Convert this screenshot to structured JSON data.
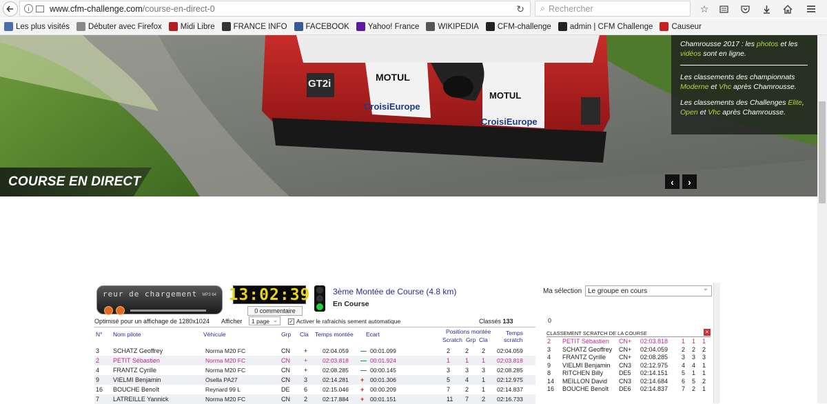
{
  "browser": {
    "url_host": "www.cfm-challenge.com",
    "url_path": "/course-en-direct-0",
    "search_placeholder": "Rechercher"
  },
  "bookmarks": [
    {
      "label": "Les plus visités",
      "icon": "star-folder-icon",
      "color": "#4a6ea9"
    },
    {
      "label": "Débuter avec Firefox",
      "icon": "firefox-icon",
      "color": "#888888"
    },
    {
      "label": "Midi Libre",
      "icon": "midi-libre-icon",
      "color": "#b01e1e"
    },
    {
      "label": "FRANCE INFO",
      "icon": "franceinfo-icon",
      "color": "#333333"
    },
    {
      "label": "FACEBOOK",
      "icon": "facebook-icon",
      "color": "#3b5998"
    },
    {
      "label": "Yahoo! France",
      "icon": "yahoo-icon",
      "color": "#5c1aa3"
    },
    {
      "label": "WIKIPEDIA",
      "icon": "wikipedia-icon",
      "color": "#555555"
    },
    {
      "label": "CFM-challenge",
      "icon": "cfm-icon",
      "color": "#222222"
    },
    {
      "label": "admin | CFM Challenge",
      "icon": "cfm-admin-icon",
      "color": "#222222"
    },
    {
      "label": "Causeur",
      "icon": "causeur-icon",
      "color": "#c62020"
    }
  ],
  "hero": {
    "title": "COURSE EN DIRECT",
    "news": {
      "p1_a": "Chamrousse 2017 : les ",
      "p1_link1": "photos",
      "p1_b": " et les ",
      "p1_link2": "vidéos",
      "p1_c": " sont en ligne.",
      "p2_a": "Les classements des championnats ",
      "p2_link1": "Moderne",
      "p2_b": " et ",
      "p2_link2": "Vhc",
      "p2_c": " après Chamrousse.",
      "p3_a": "Les classements des Challenges ",
      "p3_link1": "Elite",
      "p3_b": ", ",
      "p3_link2": "Open",
      "p3_c": " et ",
      "p3_link3": "Vhc",
      "p3_d": " après Chamrousse."
    }
  },
  "widget": {
    "player_text": "reur de chargement",
    "player_badge": "MP3 64",
    "clock": "13:02:39",
    "comment_button": "0 commentaire",
    "run_title": "3ème Montée de Course (4.8 km)",
    "run_status": "En Course",
    "optimised": "Optimisé pour un affichage de 1280x1024",
    "show_label": "Afficher",
    "page_select": "1 page",
    "auto_refresh": "Activer le rafraichis sement automatique",
    "classes_label": "Classés",
    "classes_count": "133",
    "my_selection_label": "Ma sélection",
    "my_selection_value": "Le groupe en cours",
    "side_counter": "0",
    "side_title": "CLASSEMENT SCRATCH DE LA COURSE",
    "headers": {
      "num": "N°",
      "pilot": "Nom pilote",
      "vehicle": "Véhicule",
      "grp": "Grp",
      "cla": "Cla",
      "time": "Temps montée",
      "gap": "Ecart",
      "positions": "Positions montée",
      "scratch": "Scratch",
      "pgrp": "Grp",
      "pcla": "Cla",
      "stime1": "Temps",
      "stime2": "scratch"
    },
    "rows": [
      {
        "num": "3",
        "pilot": "SCHATZ Geoffrey",
        "vehicle": "Norma M20 FC",
        "grp": "CN",
        "cla": "+",
        "time": "02:04.059",
        "sign": "—",
        "gap": "00:01.099",
        "scratch": "2",
        "pgrp": "2",
        "pcla": "2",
        "stime": "02:04.059",
        "me": false
      },
      {
        "num": "2",
        "pilot": "PETIT Sébastien",
        "vehicle": "Norma M20 FC",
        "grp": "CN",
        "cla": "+",
        "time": "02:03.818",
        "sign": "—",
        "gap": "00:01.924",
        "scratch": "1",
        "pgrp": "1",
        "pcla": "1",
        "stime": "02:03.818",
        "me": true
      },
      {
        "num": "4",
        "pilot": "FRANTZ Cyrille",
        "vehicle": "Norma M20 FC",
        "grp": "CN",
        "cla": "+",
        "time": "02:08.285",
        "sign": "—",
        "gap": "00:00.145",
        "scratch": "3",
        "pgrp": "3",
        "pcla": "3",
        "stime": "02:08.285",
        "me": false
      },
      {
        "num": "9",
        "pilot": "VIELMI Benjamin",
        "vehicle": "Osella PA27",
        "grp": "CN",
        "cla": "3",
        "time": "02:14.281",
        "sign": "+",
        "gap": "00:01.306",
        "scratch": "5",
        "pgrp": "4",
        "pcla": "1",
        "stime": "02:12.975",
        "me": false
      },
      {
        "num": "16",
        "pilot": "BOUCHE Benoît",
        "vehicle": "Reynard 99 L",
        "grp": "DE",
        "cla": "6",
        "time": "02:15.046",
        "sign": "+",
        "gap": "00:00.209",
        "scratch": "7",
        "pgrp": "2",
        "pcla": "1",
        "stime": "02:14.837",
        "me": false
      },
      {
        "num": "7",
        "pilot": "LATREILLE Yannick",
        "vehicle": "Norma M20 FC",
        "grp": "CN",
        "cla": "2",
        "time": "02:17.884",
        "sign": "+",
        "gap": "00:01.151",
        "scratch": "11",
        "pgrp": "7",
        "pcla": "2",
        "stime": "02:16.733",
        "me": false
      }
    ],
    "side_rows": [
      {
        "num": "2",
        "pilot": "PETIT Sébastien",
        "cla": "CN+",
        "time": "02:03.818",
        "a": "1",
        "b": "1",
        "c": "1",
        "me": true
      },
      {
        "num": "3",
        "pilot": "SCHATZ Geoffrey",
        "cla": "CN+",
        "time": "02:04.059",
        "a": "2",
        "b": "2",
        "c": "2",
        "me": false
      },
      {
        "num": "4",
        "pilot": "FRANTZ Cyrille",
        "cla": "CN+",
        "time": "02:08.285",
        "a": "3",
        "b": "3",
        "c": "3",
        "me": false
      },
      {
        "num": "9",
        "pilot": "VIELMI Benjamin",
        "cla": "CN3",
        "time": "02:12.975",
        "a": "4",
        "b": "4",
        "c": "1",
        "me": false
      },
      {
        "num": "8",
        "pilot": "RITCHEN Billy",
        "cla": "DE5",
        "time": "02:14.151",
        "a": "5",
        "b": "1",
        "c": "1",
        "me": false
      },
      {
        "num": "14",
        "pilot": "MEILLON David",
        "cla": "CN3",
        "time": "02:14.684",
        "a": "6",
        "b": "5",
        "c": "2",
        "me": false
      },
      {
        "num": "16",
        "pilot": "BOUCHE Benoît",
        "cla": "DE6",
        "time": "02:14.837",
        "a": "7",
        "b": "2",
        "c": "1",
        "me": false
      }
    ]
  }
}
